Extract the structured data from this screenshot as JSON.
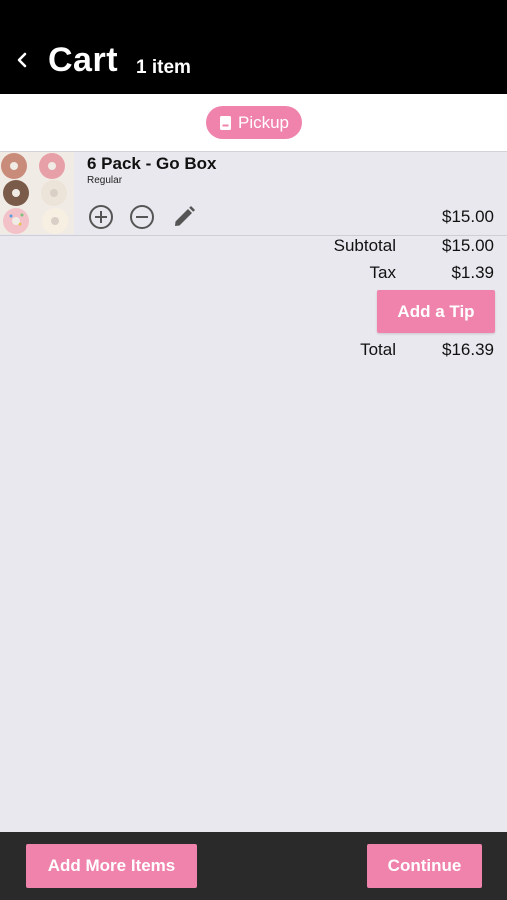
{
  "header": {
    "title": "Cart",
    "item_count": "1 item",
    "back_icon": "chevron-left-icon"
  },
  "mode": {
    "label": "Pickup",
    "icon": "receipt-icon"
  },
  "cart": {
    "items": [
      {
        "name": "6 Pack - Go Box",
        "variant": "Regular",
        "price": "$15.00",
        "image": "donut-box-photo"
      }
    ]
  },
  "summary": {
    "subtotal_label": "Subtotal",
    "subtotal_value": "$15.00",
    "tax_label": "Tax",
    "tax_value": "$1.39",
    "tip_button": "Add a Tip",
    "total_label": "Total",
    "total_value": "$16.39"
  },
  "footer": {
    "add_more_label": "Add More Items",
    "continue_label": "Continue"
  },
  "colors": {
    "accent": "#ef83ac",
    "header_bg": "#000000",
    "page_bg": "#e9e8ee",
    "footer_bg": "#2a2a2a"
  }
}
